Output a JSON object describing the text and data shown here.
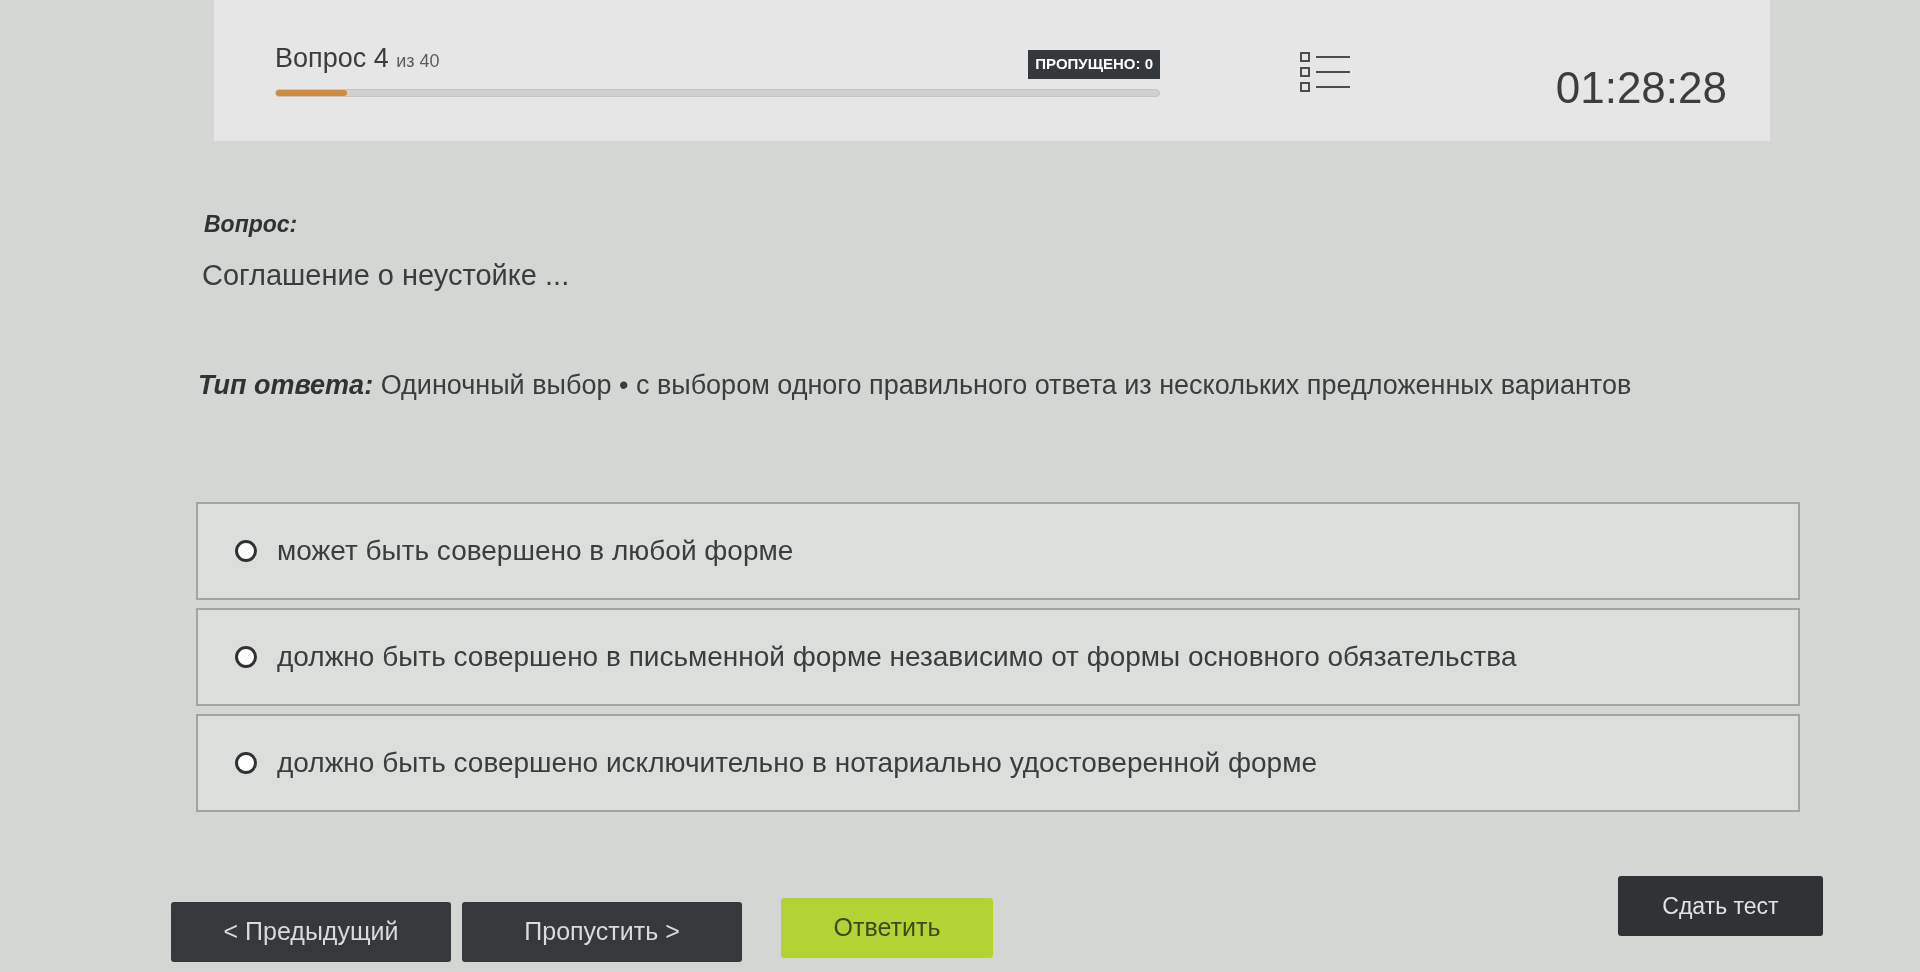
{
  "header": {
    "title": "Вопрос 4",
    "counter": "из 40",
    "progress": {
      "level": 0.08
    },
    "skipped_badge": "ПРОПУЩЕНО: 0",
    "timer": "01:28:28"
  },
  "question": {
    "label": "Вопрос:",
    "text": "Соглашение о неустойке ..."
  },
  "answer_type": {
    "label": "Тип ответа:",
    "value": "Одиночный выбор • с выбором одного правильного ответа из нескольких предложенных вариантов"
  },
  "options": [
    {
      "text": "может быть совершено в любой форме",
      "selected": false
    },
    {
      "text": "должно быть совершено в письменной форме независимо от формы основного обязательства",
      "selected": false
    },
    {
      "text": "должно быть совершено исключительно в нотариально удостоверенной форме",
      "selected": false
    }
  ],
  "buttons": [
    {
      "label": "< Предыдущий",
      "kind": "dark"
    },
    {
      "label": "Пропустить >",
      "kind": "dark"
    },
    {
      "label": "Ответить",
      "kind": "accent"
    }
  ],
  "submit_button": {
    "label": "Сдать тест"
  }
}
